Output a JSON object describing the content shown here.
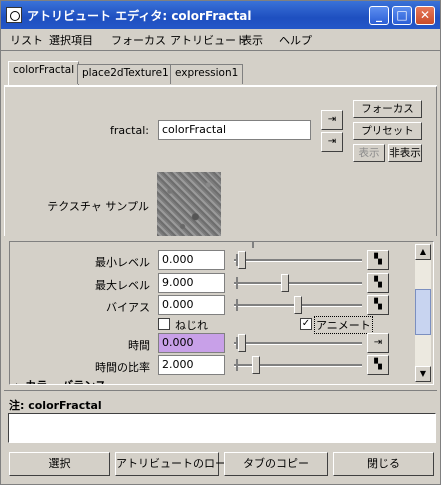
{
  "window": {
    "title": "アトリビュート エディタ: colorFractal",
    "minimize_glyph": "_",
    "maximize_glyph": "□",
    "close_glyph": "✕"
  },
  "menu": [
    "リスト",
    "選択項目",
    "フォーカス",
    "アトリビュート",
    "表示",
    "ヘルプ"
  ],
  "tabs": [
    {
      "label": "colorFractal",
      "active": true
    },
    {
      "label": "place2dTexture1",
      "active": false
    },
    {
      "label": "expression1",
      "active": false
    }
  ],
  "node": {
    "label": "fractal:",
    "value": "colorFractal",
    "focus_button": "フォーカス",
    "preset_button": "プリセット",
    "show_button": "表示",
    "hide_button": "非表示",
    "sample_label": "テクスチャ サンプル"
  },
  "attributes": [
    {
      "label": "最小レベル",
      "value": "0.000",
      "slider": 0.03
    },
    {
      "label": "最大レベル",
      "value": "9.000",
      "slider": 0.39
    },
    {
      "label": "バイアス",
      "value": "0.000",
      "slider": 0.5
    },
    {
      "label": "時間",
      "value": "0.000",
      "slider": 0.03,
      "highlight": "#c8a0e8"
    },
    {
      "label": "時間の比率",
      "value": "2.000",
      "slider": 0.15
    }
  ],
  "checkboxes": {
    "inflection_label": "ねじれ",
    "inflection_checked": false,
    "animated_label": "アニメート",
    "animated_checked": true,
    "check_glyph": "✓"
  },
  "next_section_partial": "▸ カラー バランス",
  "notes": {
    "label": "注:  colorFractal",
    "text": ""
  },
  "bottom_buttons": [
    "選択",
    "アトリビュートのロード",
    "タブのコピー",
    "閉じる"
  ],
  "icons": {
    "scroll_up": "▲",
    "scroll_down": "▼",
    "map": "▚",
    "connect": "⇥"
  }
}
